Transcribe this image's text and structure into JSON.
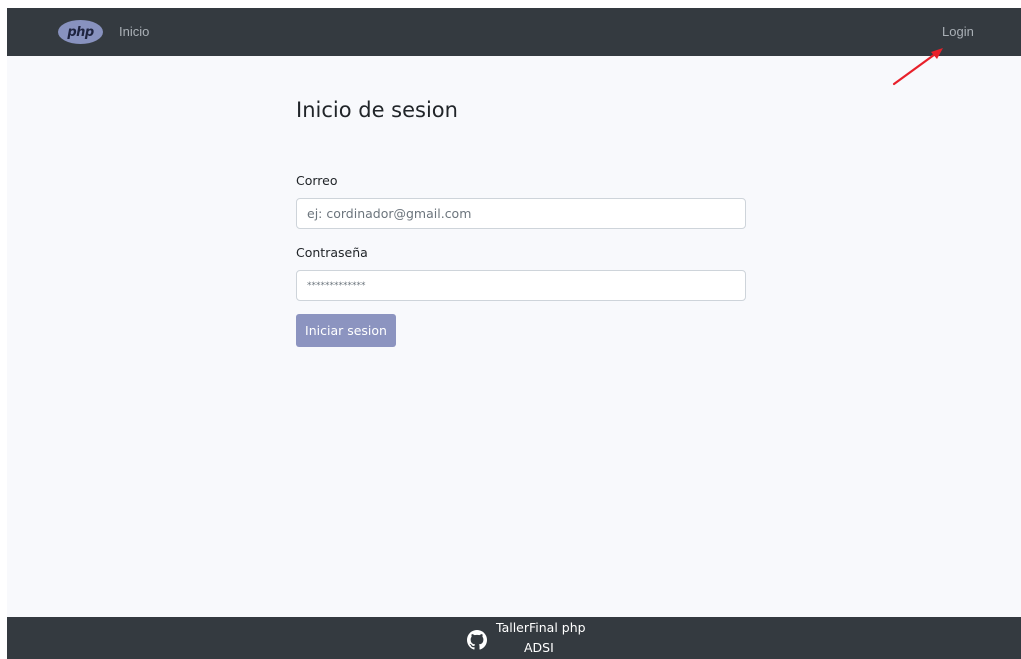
{
  "navbar": {
    "logo_text": "php",
    "home_label": "Inicio",
    "login_label": "Login"
  },
  "page": {
    "title": "Inicio de sesion"
  },
  "form": {
    "email_label": "Correo",
    "email_placeholder": "ej: cordinador@gmail.com",
    "password_label": "Contraseña",
    "password_placeholder": "*************",
    "submit_label": "Iniciar sesion"
  },
  "footer": {
    "title": "TallerFinal php",
    "subtitle": "ADSI",
    "icon": "github-icon"
  },
  "colors": {
    "navbar_bg": "#343a40",
    "page_bg": "#f8f9fc",
    "button_bg": "#8c94c0",
    "annotation_arrow": "#e8202a"
  }
}
